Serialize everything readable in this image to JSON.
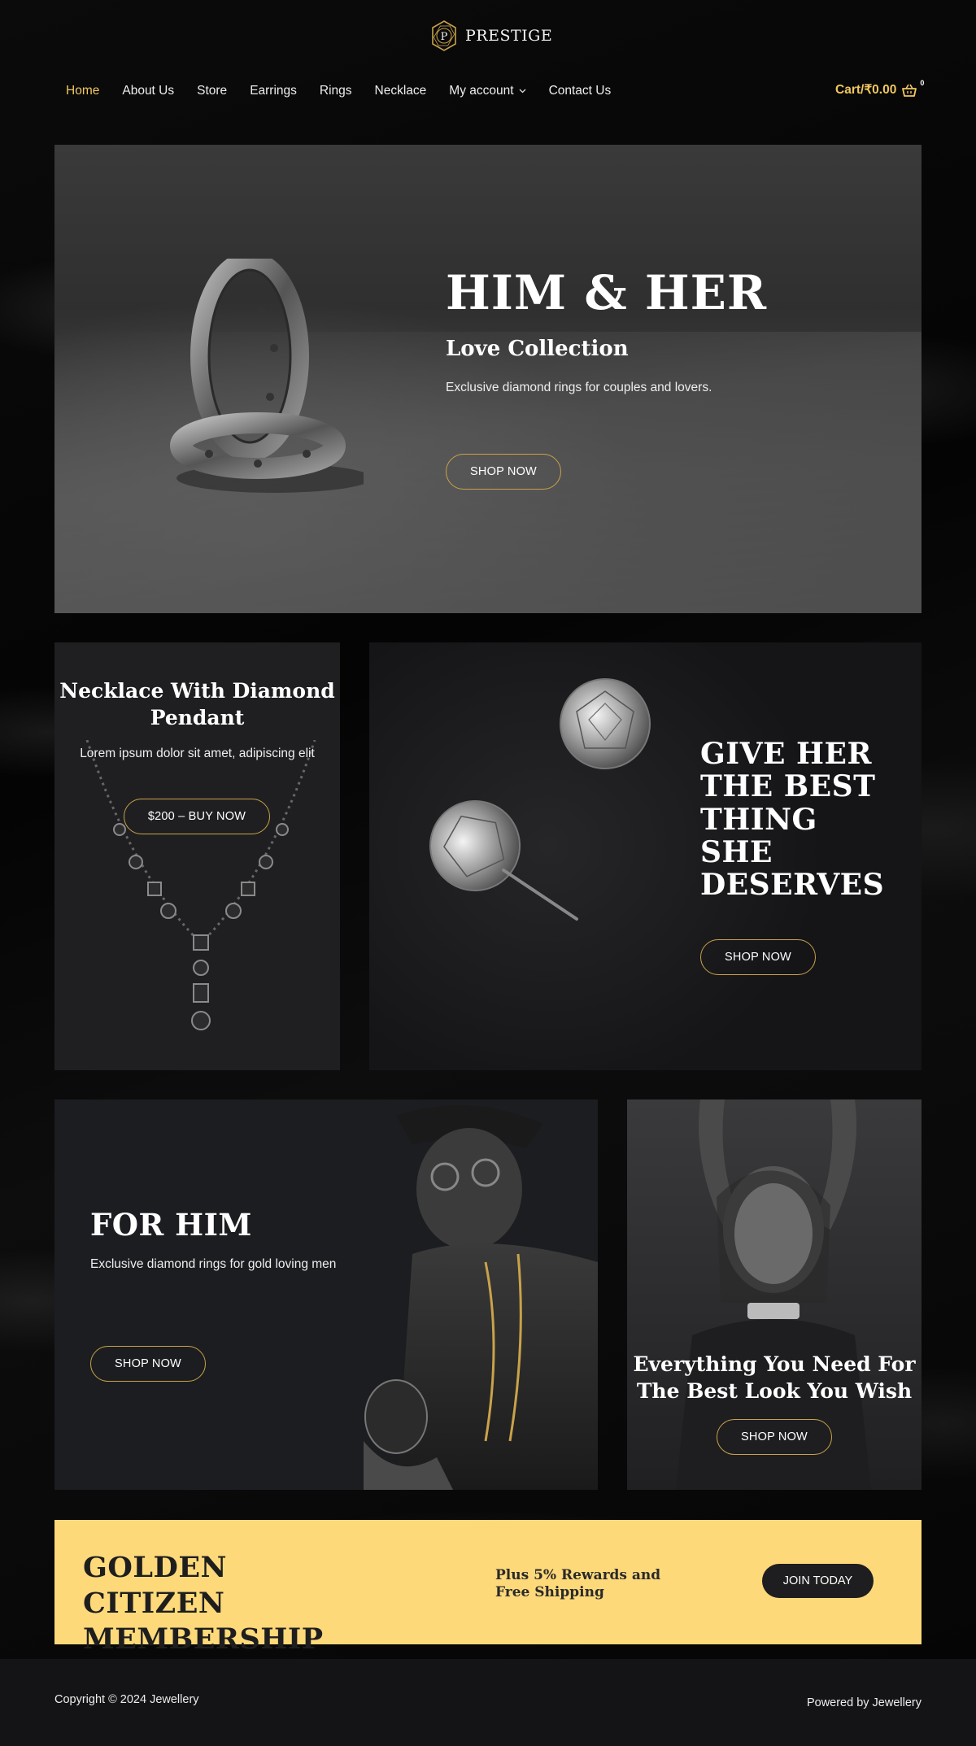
{
  "brand": {
    "name": "PRESTIGE",
    "logo_letter": "P"
  },
  "nav": {
    "items": [
      {
        "label": "Home",
        "active": true
      },
      {
        "label": "About Us"
      },
      {
        "label": "Store"
      },
      {
        "label": "Earrings"
      },
      {
        "label": "Rings"
      },
      {
        "label": "Necklace"
      },
      {
        "label": "My account",
        "has_dropdown": true
      },
      {
        "label": "Contact Us"
      }
    ]
  },
  "cart": {
    "label": "Cart/₹0.00",
    "count": "0",
    "icon": "basket-icon"
  },
  "hero": {
    "title": "HIM & HER",
    "subtitle": "Love Collection",
    "description": "Exclusive diamond rings for couples and lovers.",
    "button": "SHOP NOW"
  },
  "necklace": {
    "title": "Necklace With Diamond Pendant",
    "description": "Lorem ipsum dolor sit amet, adipiscing elit",
    "button": "$200 – BUY NOW"
  },
  "earrings": {
    "title": "GIVE HER THE BEST THING SHE DESERVES",
    "button": "SHOP NOW"
  },
  "for_him": {
    "title": "FOR HIM",
    "description": "Exclusive diamond rings for gold loving men",
    "button": "SHOP NOW"
  },
  "look": {
    "title": "Everything You Need For The Best Look You Wish",
    "button": "SHOP NOW"
  },
  "membership": {
    "title": "GOLDEN CITIZEN MEMBERSHIP",
    "offer": "Plus 5% Rewards and Free Shipping",
    "button": "JOIN TODAY"
  },
  "footer": {
    "copyright": "Copyright © 2024 Jewellery",
    "powered": "Powered by Jewellery"
  },
  "colors": {
    "accent": "#f0c760",
    "button_border": "#c9a24a",
    "membership_bg": "#fed97a",
    "page_bg": "#050505",
    "card_bg": "#1f1f21",
    "footer_bg": "#141416"
  }
}
